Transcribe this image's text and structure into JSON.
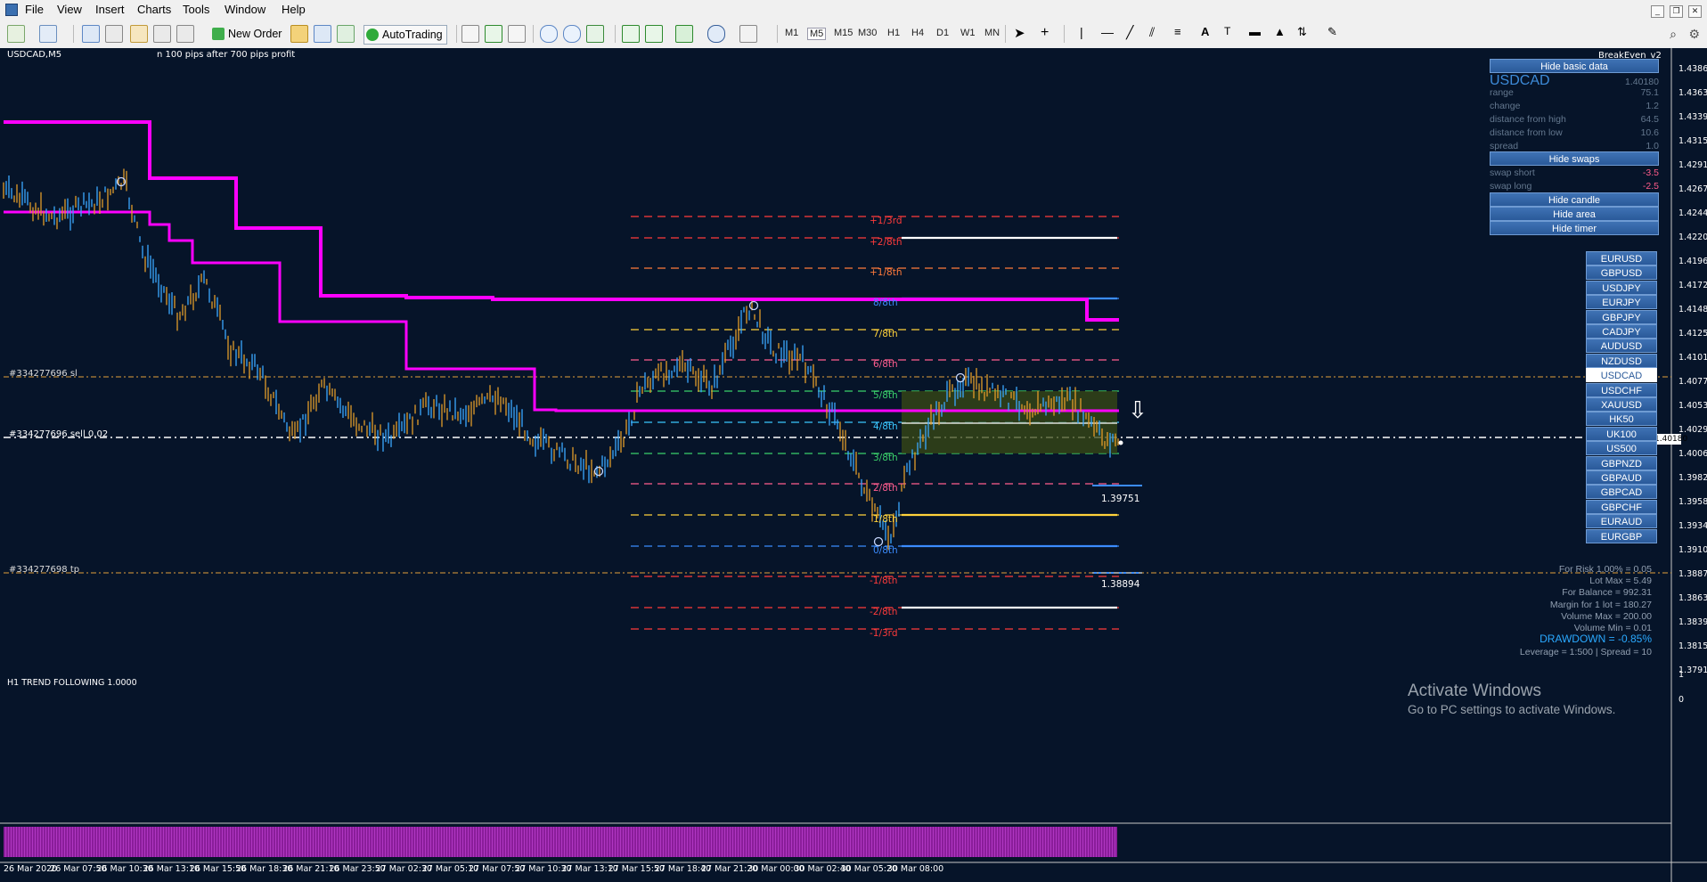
{
  "menu": [
    "File",
    "View",
    "Insert",
    "Charts",
    "Tools",
    "Window",
    "Help"
  ],
  "toolbar": {
    "new_order": "New Order",
    "autotrading": "AutoTrading",
    "timeframes": [
      "M1",
      "M5",
      "M15",
      "M30",
      "H1",
      "H4",
      "D1",
      "W1",
      "MN"
    ]
  },
  "chart": {
    "symbol_label": "USDCAD,M5",
    "comment": "n 100 pips after 700 pips profit",
    "ea_name": "BreakEven_v2",
    "sl_label": "#334277696 sl",
    "order_label": "#334277696 sell 0.02",
    "tp_label": "#334277698 tp",
    "current_price": "1.40180",
    "level_label_1": "1.39751",
    "level_label_2": "1.38894",
    "indicator_label": "H1 TREND FOLLOWING 1.0000",
    "y_ticks": [
      "1.43865",
      "1.43630",
      "1.43390",
      "1.43155",
      "1.42915",
      "1.42675",
      "1.42440",
      "1.42200",
      "1.41965",
      "1.41725",
      "1.41485",
      "1.41250",
      "1.41010",
      "1.40775",
      "1.40535",
      "1.40295",
      "1.40060",
      "1.39820",
      "1.39580",
      "1.39345",
      "1.39105",
      "1.38870",
      "1.38630",
      "1.38395",
      "1.38155",
      "1.37915"
    ],
    "indicator_y_ticks": [
      "1",
      "0"
    ],
    "x_ticks": [
      "26 Mar 2020",
      "26 Mar 07:50",
      "26 Mar 10:30",
      "26 Mar 13:10",
      "26 Mar 15:50",
      "26 Mar 18:30",
      "26 Mar 21:10",
      "26 Mar 23:50",
      "27 Mar 02:30",
      "27 Mar 05:10",
      "27 Mar 07:50",
      "27 Mar 10:30",
      "27 Mar 13:10",
      "27 Mar 15:50",
      "27 Mar 18:40",
      "27 Mar 21:20",
      "30 Mar 00:00",
      "30 Mar 02:40",
      "30 Mar 05:20",
      "30 Mar 08:00"
    ]
  },
  "murrey_levels": [
    {
      "label": "+1/3rd",
      "color": "#ff3b3b"
    },
    {
      "label": "+2/8th",
      "color": "#ff3b3b"
    },
    {
      "label": "+1/8th",
      "color": "#ff7a3b"
    },
    {
      "label": "8/8th",
      "color": "#3b8cff"
    },
    {
      "label": "7/8th",
      "color": "#ffd23b"
    },
    {
      "label": "6/8th",
      "color": "#ff5d8f"
    },
    {
      "label": "5/8th",
      "color": "#3bd16b"
    },
    {
      "label": "4/8th",
      "color": "#3bc7ff"
    },
    {
      "label": "3/8th",
      "color": "#3bd16b"
    },
    {
      "label": "2/8th",
      "color": "#ff5d8f"
    },
    {
      "label": "1/8th",
      "color": "#ffd23b"
    },
    {
      "label": "0/8th",
      "color": "#3b8cff"
    },
    {
      "label": "-1/8th",
      "color": "#ff3b3b"
    },
    {
      "label": "-2/8th",
      "color": "#ff3b3b"
    },
    {
      "label": "-1/3rd",
      "color": "#ff3b3b"
    }
  ],
  "panel": {
    "hide_basic": "Hide basic data",
    "symbol": "USDCAD",
    "price": "1.40180",
    "rows": [
      {
        "k": "range",
        "v": "75.1"
      },
      {
        "k": "change",
        "v": "1.2"
      },
      {
        "k": "distance from high",
        "v": "64.5"
      },
      {
        "k": "distance from low",
        "v": "10.6"
      },
      {
        "k": "spread",
        "v": "1.0"
      }
    ],
    "hide_swaps": "Hide swaps",
    "swaps": [
      {
        "k": "swap short",
        "v": "-3.5"
      },
      {
        "k": "swap long",
        "v": "-2.5"
      }
    ],
    "hide_candle": "Hide candle",
    "hide_area": "Hide area",
    "hide_timer": "Hide timer"
  },
  "symbols": [
    "EURUSD",
    "GBPUSD",
    "USDJPY",
    "EURJPY",
    "GBPJPY",
    "CADJPY",
    "AUDUSD",
    "NZDUSD",
    "USDCAD",
    "USDCHF",
    "XAUUSD",
    "HK50",
    "UK100",
    "US500",
    "GBPNZD",
    "GBPAUD",
    "GBPCAD",
    "GBPCHF",
    "EURAUD",
    "EURGBP"
  ],
  "selected_symbol": "USDCAD",
  "risk": [
    "For Risk 1.00% = 0.05",
    "Lot Max = 5.49",
    "For Balance = 992.31",
    "Margin for 1 lot = 180.27",
    "Volume Max = 200.00",
    "Volume Min = 0.01"
  ],
  "drawdown": "DRAWDOWN = -0.85%",
  "leverage": "Leverage = 1:500 | Spread = 10",
  "watermark": {
    "title": "Activate Windows",
    "sub": "Go to PC settings to activate Windows."
  },
  "colors": {
    "bg": "#061429",
    "ma": "#ff00ff",
    "up": "#3ba7ff",
    "down": "#e29b2a",
    "accent": "#2a5a9a"
  }
}
